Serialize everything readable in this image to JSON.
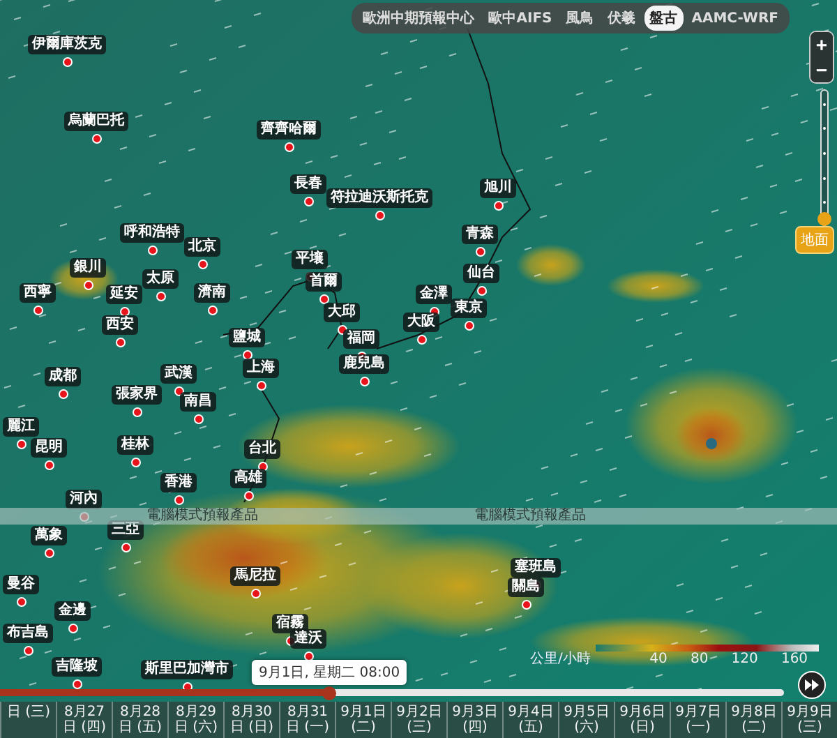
{
  "model_tabs": [
    {
      "label": "歐洲中期預報中心",
      "selected": false
    },
    {
      "label": "歐中AIFS",
      "selected": false
    },
    {
      "label": "風鳥",
      "selected": false
    },
    {
      "label": "伏羲",
      "selected": false
    },
    {
      "label": "盤古",
      "selected": true
    },
    {
      "label": "AAMC-WRF",
      "selected": false
    }
  ],
  "zoom": {
    "in": "+",
    "out": "−"
  },
  "altitude": {
    "level": 0,
    "label": "地面"
  },
  "cities": [
    {
      "name": "伊爾庫茨克"
    },
    {
      "name": "烏蘭巴托"
    },
    {
      "name": "齊齊哈爾"
    },
    {
      "name": "長春"
    },
    {
      "name": "符拉迪沃斯托克"
    },
    {
      "name": "呼和浩特"
    },
    {
      "name": "北京"
    },
    {
      "name": "銀川"
    },
    {
      "name": "太原"
    },
    {
      "name": "平壤"
    },
    {
      "name": "首爾"
    },
    {
      "name": "西寧"
    },
    {
      "name": "延安"
    },
    {
      "name": "濟南"
    },
    {
      "name": "大邱"
    },
    {
      "name": "西安"
    },
    {
      "name": "旭川"
    },
    {
      "name": "青森"
    },
    {
      "name": "仙台"
    },
    {
      "name": "金澤"
    },
    {
      "name": "東京"
    },
    {
      "name": "大阪"
    },
    {
      "name": "福岡"
    },
    {
      "name": "鹿兒島"
    },
    {
      "name": "鹽城"
    },
    {
      "name": "上海"
    },
    {
      "name": "成都"
    },
    {
      "name": "武漢"
    },
    {
      "name": "張家界"
    },
    {
      "name": "南昌"
    },
    {
      "name": "麗江"
    },
    {
      "name": "昆明"
    },
    {
      "name": "桂林"
    },
    {
      "name": "台北"
    },
    {
      "name": "高雄"
    },
    {
      "name": "香港"
    },
    {
      "name": "河內"
    },
    {
      "name": "三亞"
    },
    {
      "name": "萬象"
    },
    {
      "name": "馬尼拉"
    },
    {
      "name": "曼谷"
    },
    {
      "name": "金邊"
    },
    {
      "name": "宿霧"
    },
    {
      "name": "布吉島"
    },
    {
      "name": "達沃"
    },
    {
      "name": "吉隆坡"
    },
    {
      "name": "斯里巴加灣市"
    },
    {
      "name": "塞班島"
    },
    {
      "name": "關島"
    }
  ],
  "notice": [
    "電腦模式預報產品",
    "電腦模式預報產品"
  ],
  "legend": {
    "unit": "公里/小時",
    "ticks": [
      "40",
      "80",
      "120",
      "160"
    ]
  },
  "timeline": {
    "level": 0.42,
    "tooltip": "9月1日, 星期二 08:00",
    "days": [
      "日 (三)",
      "8月27日 (四)",
      "8月28日 (五)",
      "8月29日 (六)",
      "8月30日 (日)",
      "8月31日 (一)",
      "9月1日 (二)",
      "9月2日 (三)",
      "9月3日 (四)",
      "9月4日 (五)",
      "9月5日 (六)",
      "9月6日 (日)",
      "9月7日 (一)",
      "9月8日 (二)",
      "9月9日 (三)"
    ]
  }
}
